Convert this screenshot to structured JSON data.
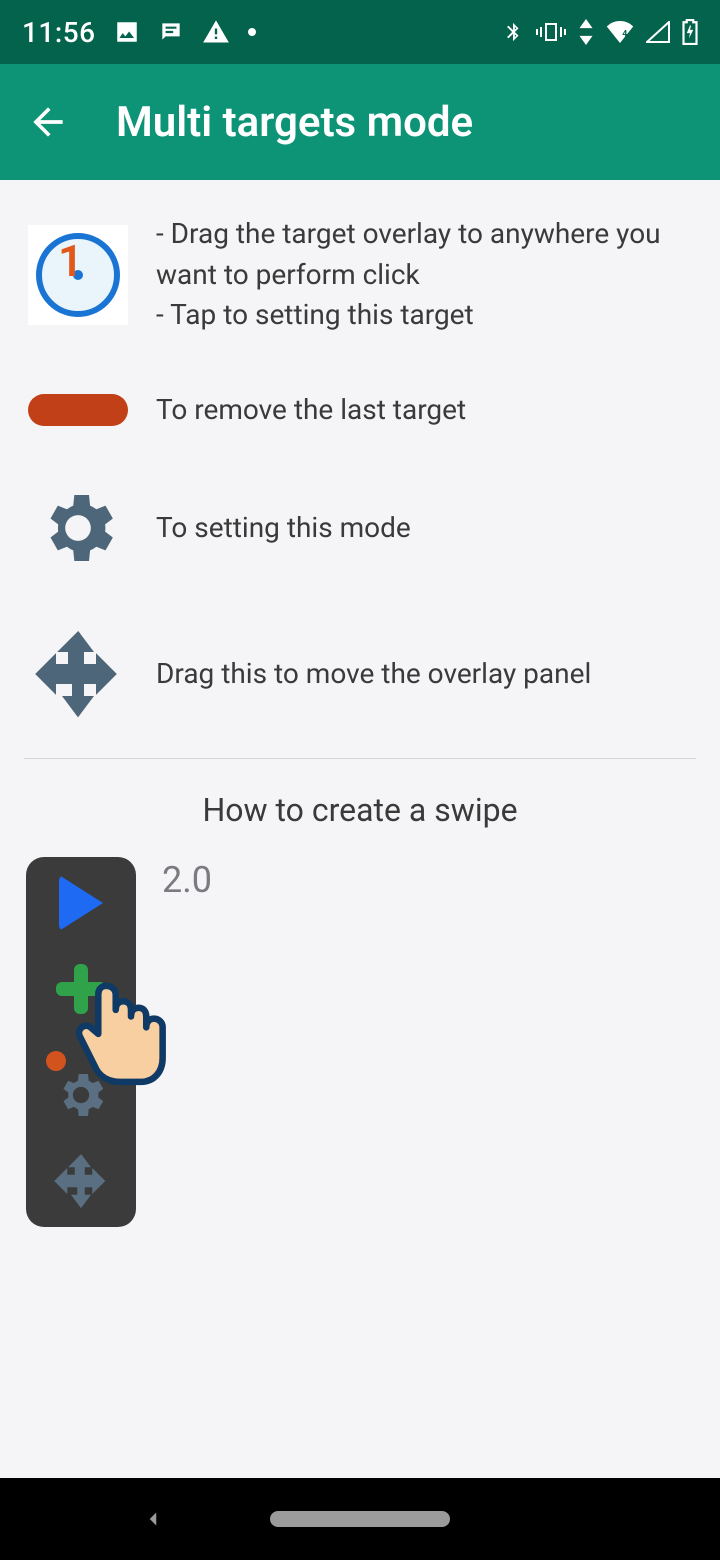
{
  "statusbar": {
    "time": "11:56"
  },
  "appbar": {
    "title": "Multi targets mode"
  },
  "rows": {
    "target": {
      "line1": "- Drag the target overlay to anywhere you want to perform click",
      "line2": "- Tap to setting this target",
      "number": "1"
    },
    "remove": "To remove the last target",
    "settings": "To setting this mode",
    "move": "Drag this to move the overlay panel"
  },
  "swipe": {
    "heading": "How to create a swipe",
    "version": "2.0"
  }
}
